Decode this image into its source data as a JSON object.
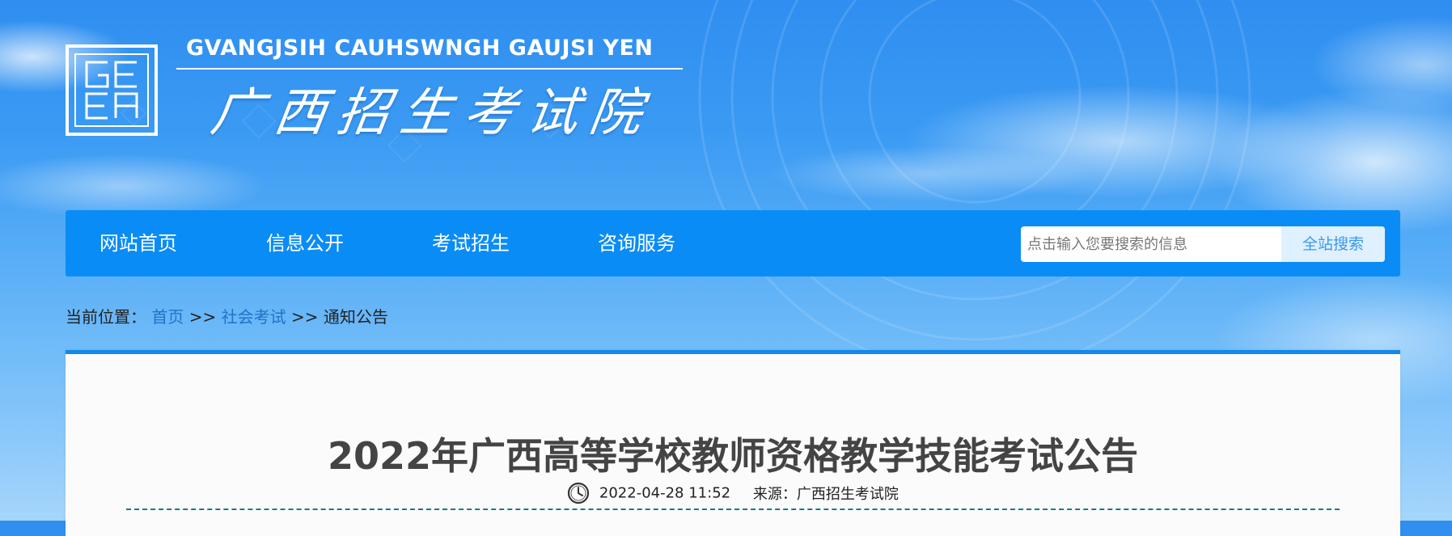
{
  "header": {
    "logo_alt": "GEEA",
    "pinyin_title": "GVANGJSIH CAUHSWNGH GAUJSI YEN",
    "chinese_title": "广西招生考试院"
  },
  "nav": {
    "items": [
      {
        "label": "网站首页"
      },
      {
        "label": "信息公开"
      },
      {
        "label": "考试招生"
      },
      {
        "label": "咨询服务"
      }
    ]
  },
  "search": {
    "placeholder": "点击输入您要搜索的信息",
    "button_label": "全站搜索"
  },
  "breadcrumb": {
    "prefix": "当前位置：",
    "home": "首页",
    "sep1": " >> ",
    "category": "社会考试",
    "sep2": ">> ",
    "current": "通知公告"
  },
  "article": {
    "title": "2022年广西高等学校教师资格教学技能考试公告",
    "datetime": "2022-04-28 11:52",
    "source_label": "来源：",
    "source": "广西招生考试院"
  },
  "colors": {
    "nav_bg": "#0a8cf6",
    "accent_border": "#1088ee",
    "link": "#1d73c9",
    "search_button_bg": "#dff0fe",
    "search_button_text": "#3c98ec"
  },
  "icons": [
    "logo-icon",
    "clock-icon"
  ]
}
